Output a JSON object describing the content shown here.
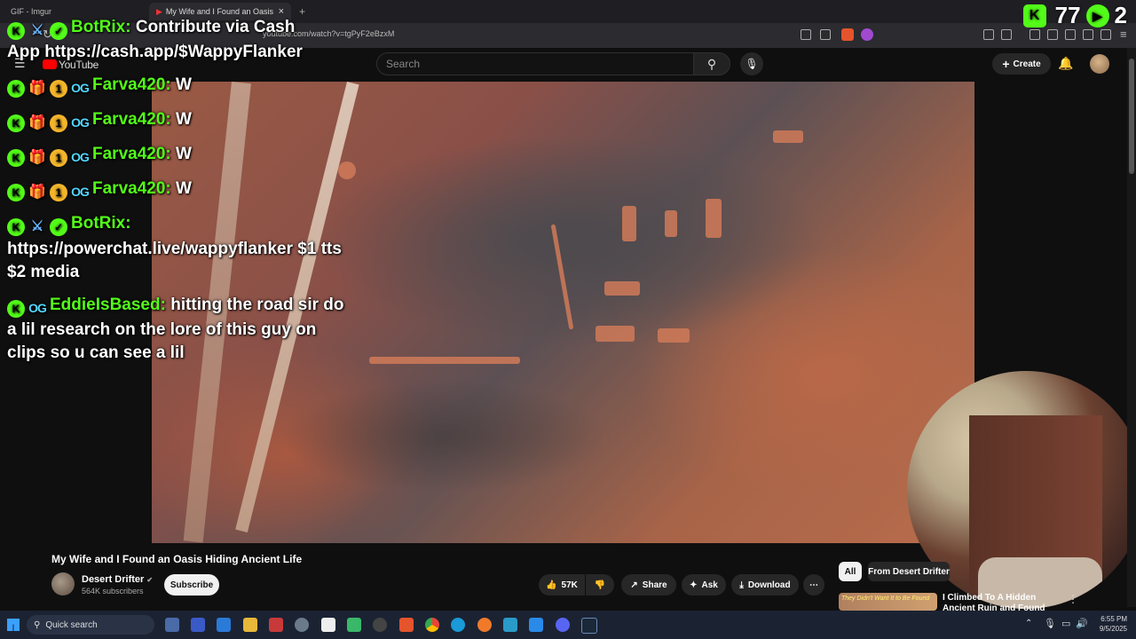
{
  "browser": {
    "tabs": [
      {
        "label": "GIF - Imgur"
      },
      {
        "label": "My Wife and I Found an Oasis"
      }
    ],
    "url": "youtube.com/watch?v=tgPyF2eBzxM",
    "new_tab_glyph": "+",
    "close_glyph": "×"
  },
  "youtube": {
    "logo_text": "YouTube",
    "search_placeholder": "Search",
    "create_label": "Create",
    "video_title": "My Wife and I Found an Oasis Hiding Ancient Life",
    "channel": {
      "name": "Desert Drifter",
      "subscribers": "564K subscribers"
    },
    "subscribe_label": "Subscribe",
    "actions": {
      "likes": "57K",
      "share": "Share",
      "ask": "Ask",
      "download": "Download"
    },
    "chips": {
      "all": "All",
      "from_channel": "From Desert Drifter"
    },
    "recommended": {
      "title": "I Climbed To A Hidden Ancient Ruin and Found Something I've",
      "thumb_text": "They Didn't Want It to Be Found"
    }
  },
  "overlay": {
    "counter": {
      "kick_viewers": "77",
      "other_viewers": "2"
    },
    "chat": [
      {
        "user": "BotRix:",
        "text": "Contribute via Cash"
      },
      {
        "user": "",
        "text": "App https://cash.app/$WappyFlanker"
      },
      {
        "user": "Farva420:",
        "text": "W"
      },
      {
        "user": "Farva420:",
        "text": "W"
      },
      {
        "user": "Farva420:",
        "text": "W"
      },
      {
        "user": "Farva420:",
        "text": "W"
      },
      {
        "user": "BotRix:",
        "text": ""
      },
      {
        "user": "",
        "text": "https://powerchat.live/wappyflanker $1 tts"
      },
      {
        "user": "",
        "text": "$2 media"
      },
      {
        "user": "EddieIsBased:",
        "text": "hitting the road sir do"
      },
      {
        "user": "",
        "text": "a lil research on the lore of this guy on"
      },
      {
        "user": "",
        "text": "clips so u can see a lil"
      }
    ]
  },
  "taskbar": {
    "search_label": "Quick search",
    "time": "6:55 PM",
    "date": "9/5/2025"
  },
  "colors": {
    "kick_green": "#53fc18",
    "yt_bg": "#0f0f0f",
    "taskbar": "#1b2333"
  }
}
